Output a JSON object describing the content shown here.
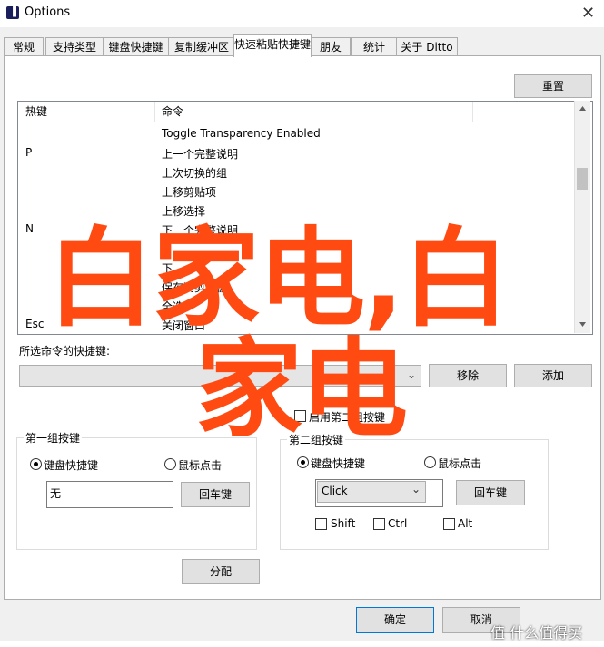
{
  "window": {
    "title": "Options",
    "icon_glyph": "▐",
    "close_glyph": "✕"
  },
  "tabs": [
    "常规",
    "支持类型",
    "键盘快捷键",
    "复制缓冲区",
    "快速粘贴快捷键",
    "朋友",
    "统计",
    "关于 Ditto"
  ],
  "active_tab": "快速粘贴快捷键",
  "reset_label": "重置",
  "table": {
    "headers": [
      "热键",
      "命令"
    ],
    "rows": [
      {
        "key": "",
        "cmd": "Toggle Transparency Enabled"
      },
      {
        "key": "P",
        "cmd": "上一个完整说明"
      },
      {
        "key": "",
        "cmd": "上次切换的组"
      },
      {
        "key": "",
        "cmd": "上移剪贴项"
      },
      {
        "key": "",
        "cmd": "上移选择"
      },
      {
        "key": "N",
        "cmd": "下一个完整说明"
      },
      {
        "key": "",
        "cmd": ""
      },
      {
        "key": "",
        "cmd": "下"
      },
      {
        "key": "",
        "cmd": "保存到剪贴板"
      },
      {
        "key": "",
        "cmd": "全选"
      },
      {
        "key": "Esc",
        "cmd": "关闭窗口"
      }
    ]
  },
  "selected_cmd_label": "所选命令的快捷键:",
  "remove_label": "移除",
  "add_label": "添加",
  "global_hotkey_label": "启用第二组按键",
  "group1": {
    "title": "第一组按键",
    "keyboard_label": "键盘快捷键",
    "mouse_label": "鼠标点击",
    "value": "无",
    "enter_label": "回车键"
  },
  "group2": {
    "title": "第二组按键",
    "keyboard_label": "键盘快捷键",
    "mouse_label": "鼠标点击",
    "click_value": "Click",
    "enter_label": "回车键",
    "shift_label": "Shift",
    "ctrl_label": "Ctrl",
    "alt_label": "Alt"
  },
  "assign_label": "分配",
  "ok_label": "确定",
  "cancel_label": "取消",
  "watermark": {
    "line1": "白家电,白",
    "line2": "家电",
    "corner": "值 什么值得买",
    "color": "#ff4a12"
  }
}
